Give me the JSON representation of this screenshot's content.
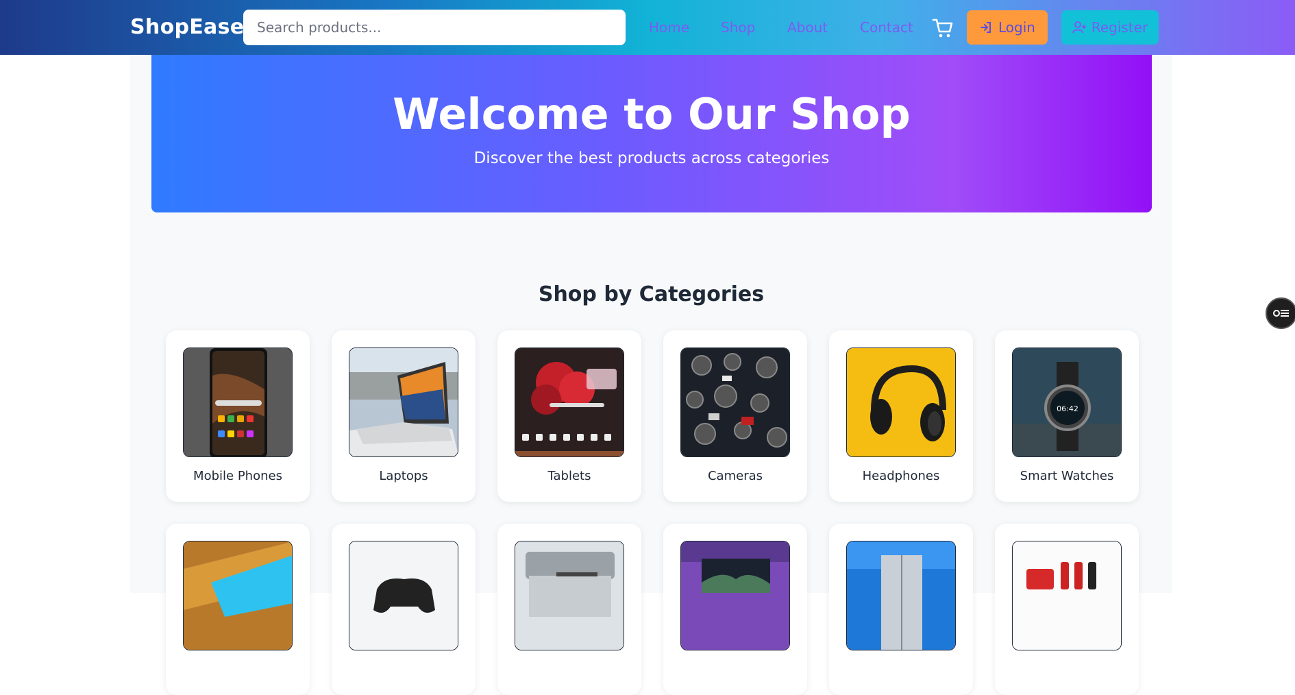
{
  "brand": "ShopEase",
  "search": {
    "placeholder": "Search products..."
  },
  "nav": {
    "home": "Home",
    "shop": "Shop",
    "about": "About",
    "contact": "Contact"
  },
  "buttons": {
    "login": "Login",
    "register": "Register"
  },
  "hero": {
    "title": "Welcome to Our Shop",
    "subtitle": "Discover the best products across categories"
  },
  "section_title": "Shop by Categories",
  "categories": [
    {
      "label": "Mobile Phones",
      "image": "smartphone-photo"
    },
    {
      "label": "Laptops",
      "image": "laptop-photo"
    },
    {
      "label": "Tablets",
      "image": "tablet-photo"
    },
    {
      "label": "Cameras",
      "image": "cameras-photo"
    },
    {
      "label": "Headphones",
      "image": "headphones-photo"
    },
    {
      "label": "Smart Watches",
      "image": "smartwatch-photo"
    }
  ],
  "categories_row2": [
    {
      "image": "tv-photo"
    },
    {
      "image": "gamepad-photo"
    },
    {
      "image": "printer-photo"
    },
    {
      "image": "monitor-photo"
    },
    {
      "image": "refrigerator-photo"
    },
    {
      "image": "kitchen-appliances-photo"
    }
  ],
  "colors": {
    "login_bg": "#ff9a3c",
    "register_bg": "#12c0d8",
    "nav_link": "#7c5cf0"
  }
}
